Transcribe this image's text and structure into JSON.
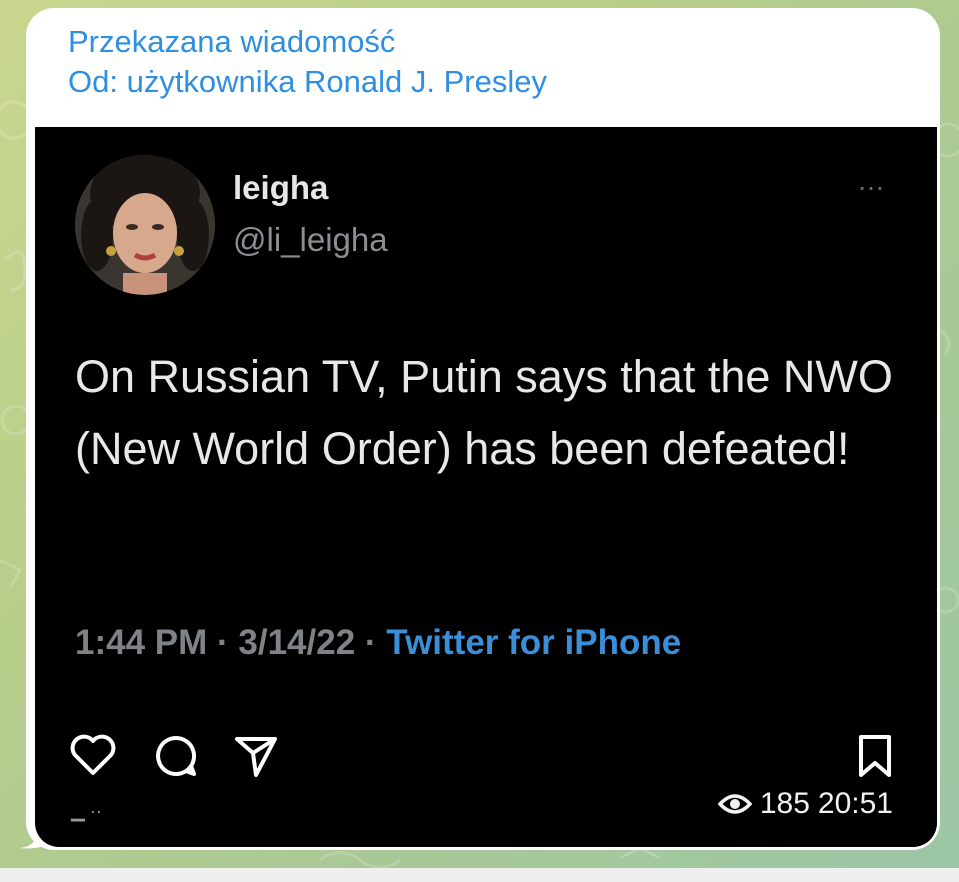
{
  "forward": {
    "line1": "Przekazana wiadomość",
    "line2": "Od: użytkownika Ronald J. Presley"
  },
  "tweet": {
    "display_name": "leigha",
    "handle": "@li_leigha",
    "text": "On Russian TV, Putin says that the NWO (New World Order) has been defeated!",
    "time": "1:44 PM",
    "separator1": " · ",
    "date": "3/14/22",
    "separator2": " · ",
    "source": "Twitter for iPhone",
    "more_icon": "…"
  },
  "actions": {
    "like_icon": "heart-icon",
    "comment_icon": "comment-icon",
    "share_icon": "send-icon",
    "save_icon": "bookmark-icon"
  },
  "message_footer": {
    "views": "185",
    "time": "20:51"
  },
  "colors": {
    "link_blue": "#2f8fe0",
    "tweet_source_blue": "#3b8fd8",
    "tweet_bg": "#000000"
  }
}
